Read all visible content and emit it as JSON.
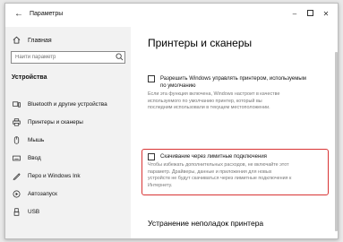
{
  "window": {
    "title": "Параметры",
    "controls": {
      "minimize": "–",
      "close": "✕"
    }
  },
  "sidebar": {
    "home_label": "Главная",
    "search_placeholder": "Найти параметр",
    "section_title": "Устройства",
    "items": [
      {
        "label": "Bluetooth и другие устройства",
        "icon": "bluetooth-devices-icon"
      },
      {
        "label": "Принтеры и сканеры",
        "icon": "printer-icon"
      },
      {
        "label": "Мышь",
        "icon": "mouse-icon"
      },
      {
        "label": "Ввод",
        "icon": "keyboard-icon"
      },
      {
        "label": "Перо и Windows Ink",
        "icon": "pen-icon"
      },
      {
        "label": "Автозапуск",
        "icon": "autoplay-icon"
      },
      {
        "label": "USB",
        "icon": "usb-icon"
      }
    ]
  },
  "main": {
    "title": "Принтеры и сканеры",
    "option1": {
      "label_line1": "Разрешить Windows управлять принтером, используемым",
      "label_line2": "по умолчанию",
      "desc_lines": [
        "Если эта функция включена, Windows настроит в качестве",
        "используемого по умолчанию принтер, который вы",
        "последним использовали в текущем местоположении."
      ],
      "checked": false
    },
    "option2": {
      "label": "Скачивание через лимитные подключения",
      "desc_lines": [
        "Чтобы избежать дополнительных расходов, не включайте этот",
        "параметр. Драйверы, данные и приложения для новых",
        "устройств не будут скачиваться через лимитные подключения к",
        "Интернету."
      ],
      "checked": false
    },
    "section2_title": "Устранение неполадок принтера"
  },
  "colors": {
    "highlight": "#d93434",
    "sidebar_bg": "#f2f2f2"
  }
}
